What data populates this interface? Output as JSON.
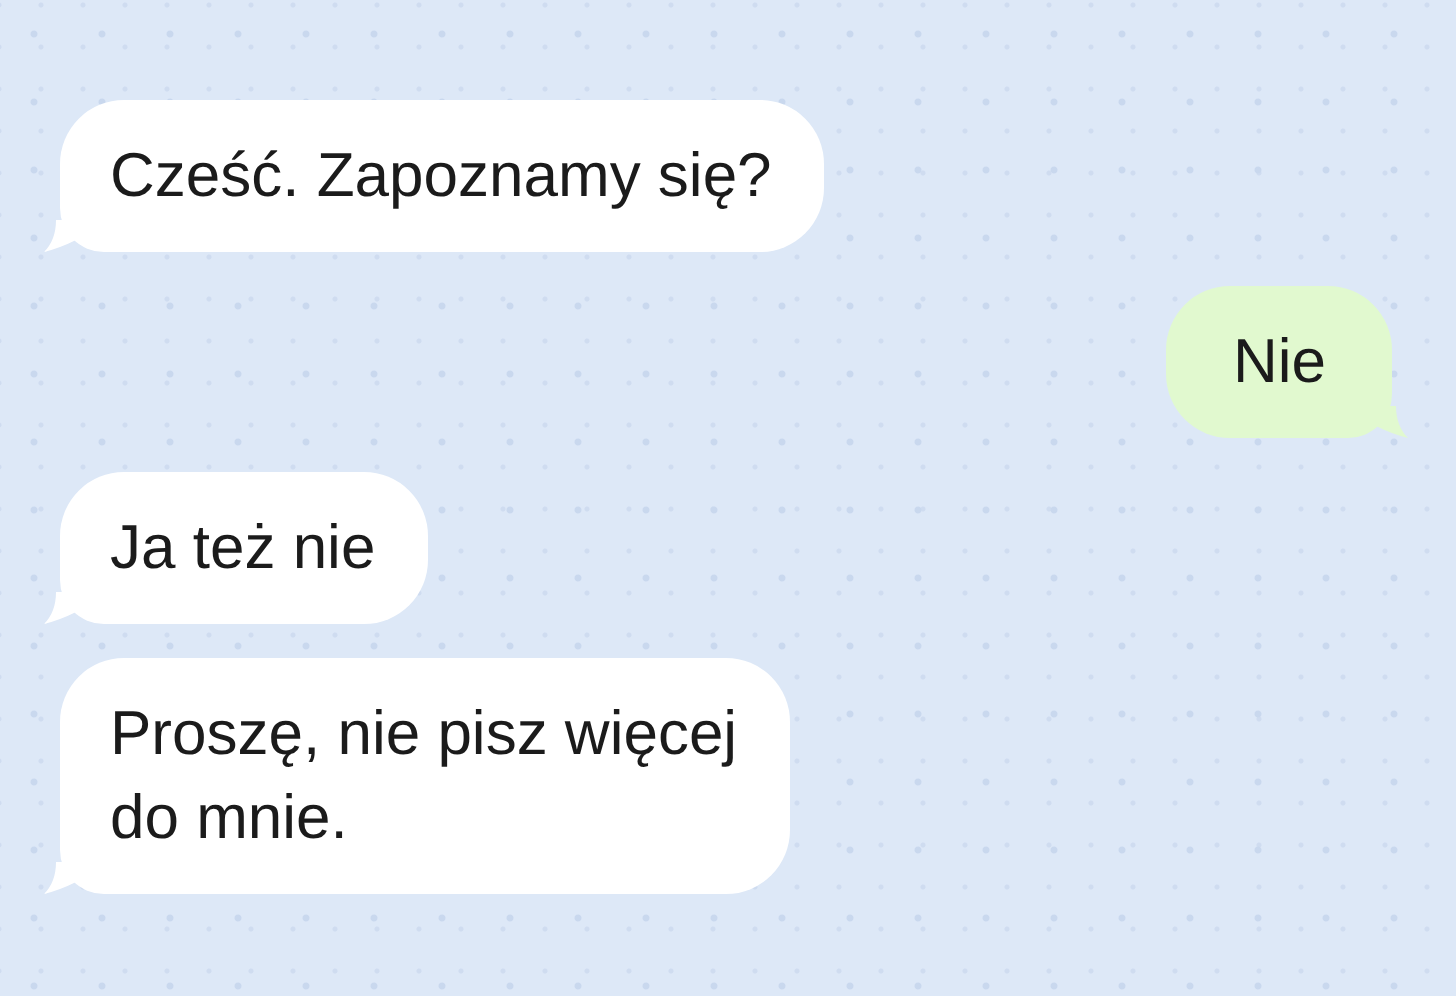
{
  "messages": [
    {
      "kind": "incoming",
      "text": "Cześć. Zapoznamy się?"
    },
    {
      "kind": "outgoing",
      "text": "Nie"
    },
    {
      "kind": "incoming",
      "text": "Ja też nie"
    },
    {
      "kind": "incoming",
      "text": "Proszę, nie pisz więcej\ndo mnie."
    }
  ]
}
